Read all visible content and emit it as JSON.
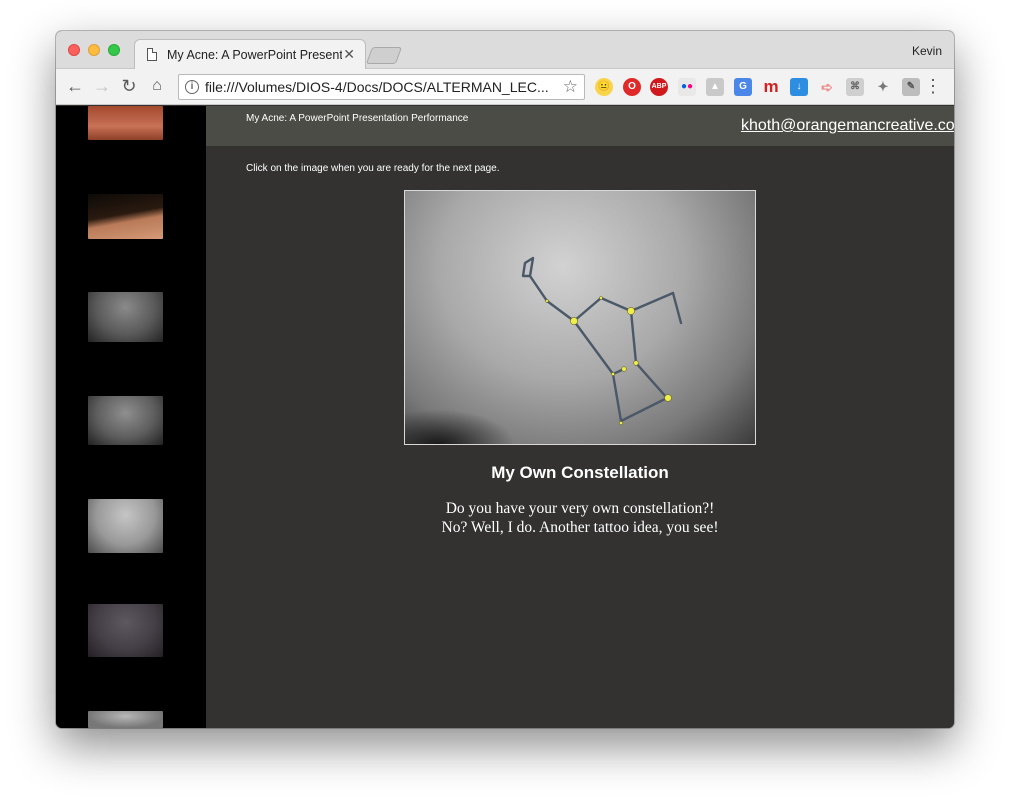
{
  "browser": {
    "tab_title": "My Acne: A PowerPoint Presentation Performance",
    "user_name": "Kevin",
    "url": "file:///Volumes/DIOS-4/Docs/DOCS/ALTERMAN_LEC...",
    "extensions": [
      "emoji-icon",
      "opera-icon",
      "adblock-plus-icon",
      "flickr-icon",
      "drive-icon",
      "google-translate-icon",
      "m-icon",
      "download-icon",
      "arrow-icon",
      "reader-icon",
      "satellite-icon",
      "tools-icon"
    ],
    "ext_labels": {
      "abp": "ABP",
      "m": "m"
    }
  },
  "page": {
    "title": "My Acne: A PowerPoint Presentation Performance",
    "email": "khoth@orangemancreative.com",
    "instruction": "Click on the image when you are ready for the next page.",
    "slide_heading": "My Own Constellation",
    "slide_body_line1": "Do you have your very own constellation?!",
    "slide_body_line2": "No? Well, I do. Another tattoo idea, you see!"
  },
  "colors": {
    "page_bg": "#333230",
    "header_band": "#4b4c46",
    "rail": "#000000",
    "constellation_star": "#f0ee4a"
  }
}
